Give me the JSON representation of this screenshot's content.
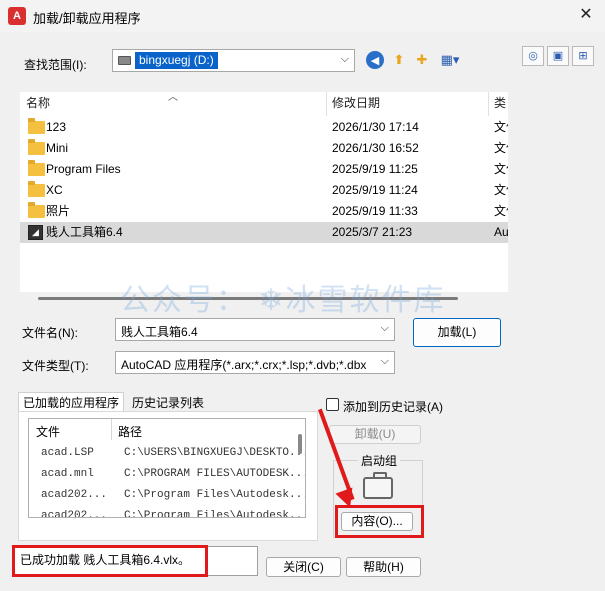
{
  "window": {
    "title": "加载/卸载应用程序",
    "app_icon": "A",
    "close": "✕"
  },
  "lookin": {
    "label": "查找范围(I):",
    "value": "bingxuegj (D:)"
  },
  "filelist": {
    "headers": [
      "名称",
      "修改日期",
      "类型"
    ],
    "rows": [
      {
        "name": "123",
        "date": "2026/1/30 17:14",
        "type": "文件"
      },
      {
        "name": "Mini",
        "date": "2026/1/30 16:52",
        "type": "文件"
      },
      {
        "name": "Program Files",
        "date": "2025/9/19 11:25",
        "type": "文件"
      },
      {
        "name": "XC",
        "date": "2025/9/19 11:24",
        "type": "文件"
      },
      {
        "name": "照片",
        "date": "2025/9/19 11:33",
        "type": "文件"
      },
      {
        "name": "贱人工具箱6.4",
        "date": "2025/3/7 21:23",
        "type": "Au"
      }
    ]
  },
  "watermark": "公众号： ❄冰雪软件库",
  "filename": {
    "label": "文件名(N):",
    "value": "贱人工具箱6.4"
  },
  "filetype": {
    "label": "文件类型(T):",
    "value": "AutoCAD 应用程序(*.arx;*.crx;*.lsp;*.dvb;*.dbx"
  },
  "buttons": {
    "load": "加载(L)",
    "unload": "卸载(U)",
    "contents": "内容(O)...",
    "close": "关闭(C)",
    "help": "帮助(H)"
  },
  "tabs": {
    "loaded": "已加载的应用程序",
    "history": "历史记录列表"
  },
  "loaded_list": {
    "headers": [
      "文件",
      "路径"
    ],
    "rows": [
      {
        "file": "acad.LSP",
        "path": "C:\\USERS\\BINGXUEGJ\\DESKTO..."
      },
      {
        "file": "acad.mnl",
        "path": "C:\\PROGRAM FILES\\AUTODESK..."
      },
      {
        "file": "acad202...",
        "path": "C:\\Program Files\\Autodesk..."
      },
      {
        "file": "acad202...",
        "path": "C:\\Program Files\\Autodesk..."
      }
    ]
  },
  "add_history": "添加到历史记录(A)",
  "startup_group": "启动组",
  "status": "已成功加载 贱人工具箱6.4.vlx。",
  "colors": {
    "highlight": "#0a63c9",
    "annotation_red": "#e0191b",
    "selected_row": "#d9d9d9"
  }
}
